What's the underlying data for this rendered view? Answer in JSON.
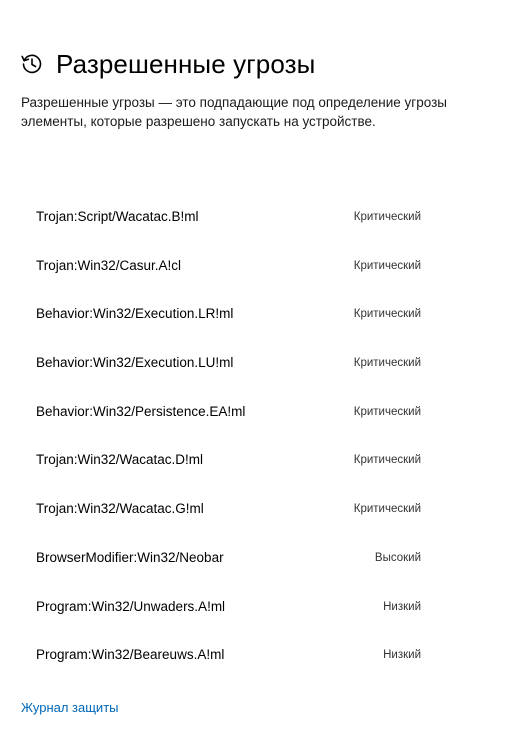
{
  "header": {
    "title": "Разрешенные угрозы",
    "icon": "history-icon"
  },
  "description": "Разрешенные угрозы — это подпадающие под определение угрозы элементы, которые разрешено запускать на устройстве.",
  "threats": [
    {
      "name": "Trojan:Script/Wacatac.B!ml",
      "level": "Критический"
    },
    {
      "name": "Trojan:Win32/Casur.A!cl",
      "level": "Критический"
    },
    {
      "name": "Behavior:Win32/Execution.LR!ml",
      "level": "Критический"
    },
    {
      "name": "Behavior:Win32/Execution.LU!ml",
      "level": "Критический"
    },
    {
      "name": "Behavior:Win32/Persistence.EA!ml",
      "level": "Критический"
    },
    {
      "name": "Trojan:Win32/Wacatac.D!ml",
      "level": "Критический"
    },
    {
      "name": "Trojan:Win32/Wacatac.G!ml",
      "level": "Критический"
    },
    {
      "name": "BrowserModifier:Win32/Neobar",
      "level": "Высокий"
    },
    {
      "name": "Program:Win32/Unwaders.A!ml",
      "level": "Низкий"
    },
    {
      "name": "Program:Win32/Beareuws.A!ml",
      "level": "Низкий"
    }
  ],
  "footer": {
    "history_link": "Журнал защиты"
  },
  "colors": {
    "link": "#0067b8",
    "text": "#000000",
    "background": "#ffffff"
  }
}
